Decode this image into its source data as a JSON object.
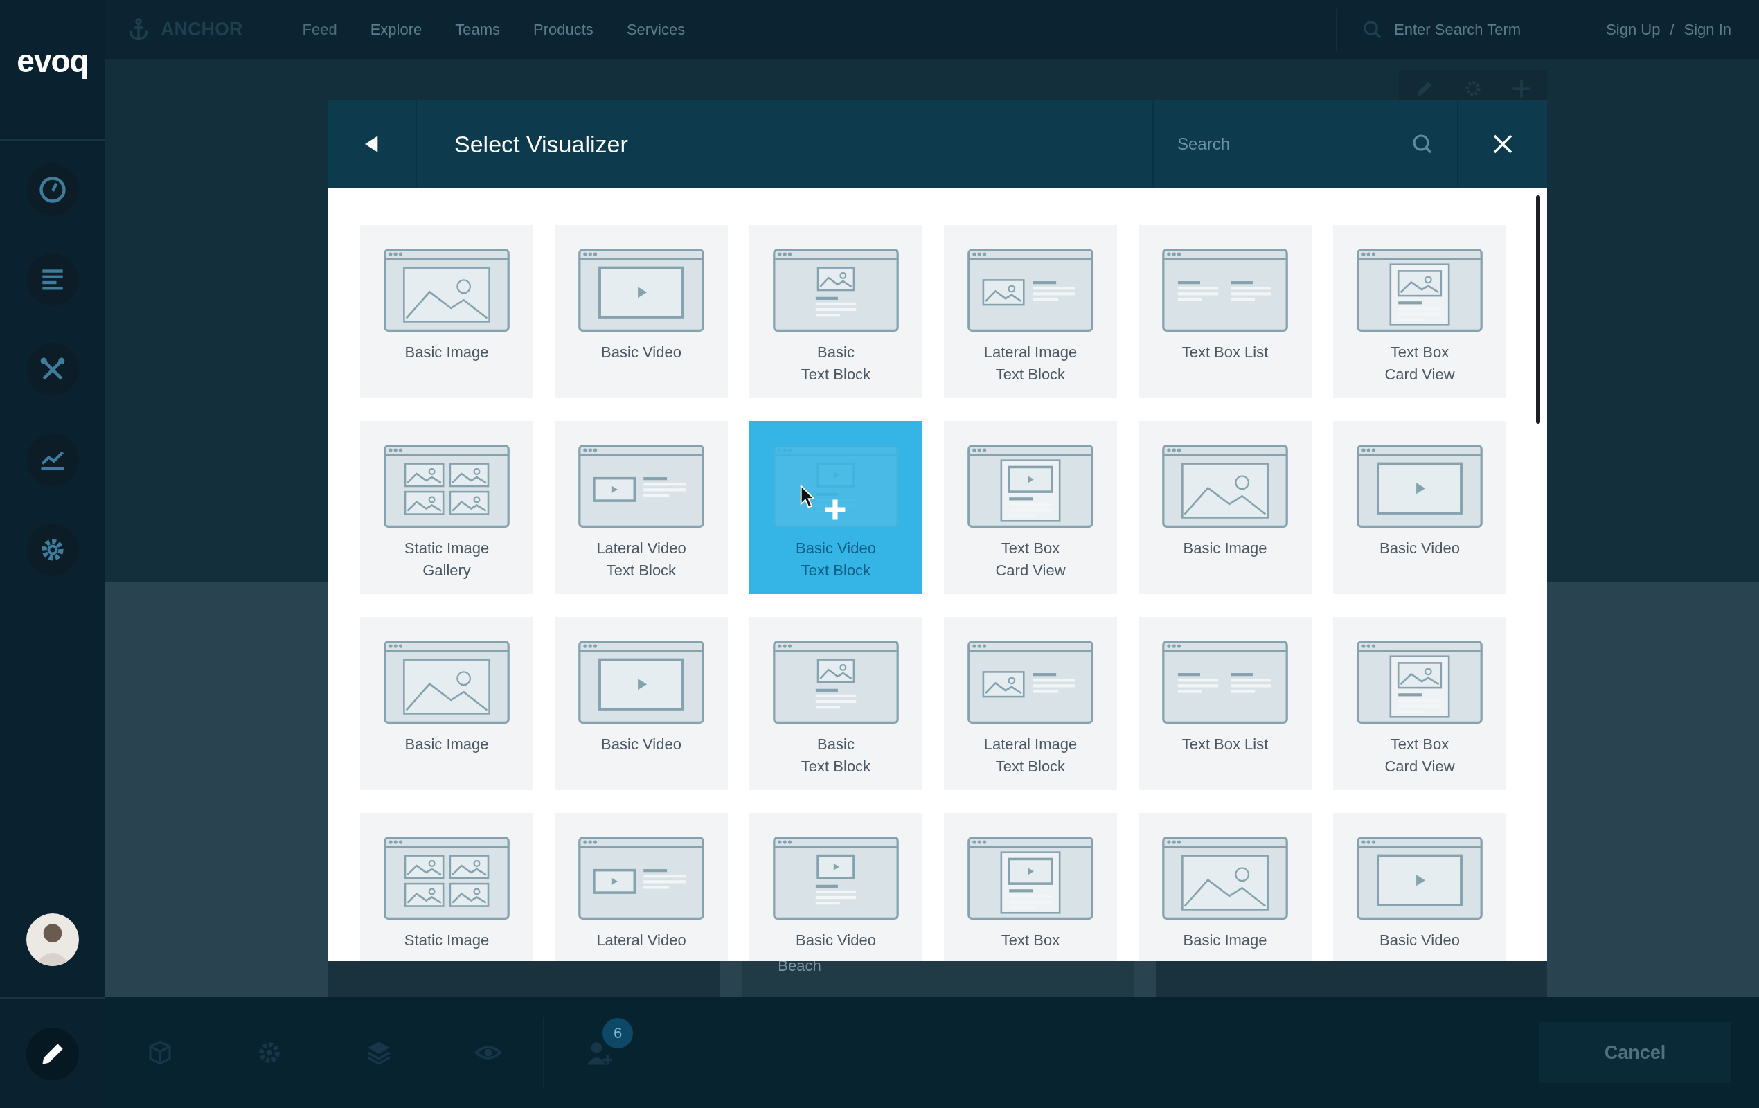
{
  "top_nav": {
    "brand": "ANCHOR",
    "links": [
      "Feed",
      "Explore",
      "Teams",
      "Products",
      "Services"
    ],
    "search_placeholder": "Enter Search Term",
    "sign_up": "Sign Up",
    "separator": "/",
    "sign_in": "Sign In"
  },
  "sidebar": {
    "logo": "evoq",
    "items": [
      {
        "kind": "dashboard"
      },
      {
        "kind": "content"
      },
      {
        "kind": "tools"
      },
      {
        "kind": "analytics"
      },
      {
        "kind": "settings"
      }
    ],
    "edit_button": {
      "kind": "pencil"
    }
  },
  "page": {
    "caption": "Beach"
  },
  "modal": {
    "title": "Select Visualizer",
    "search_placeholder": "Search",
    "tiles": [
      {
        "kind": "basic-image",
        "label": [
          "Basic Image"
        ],
        "selected": false
      },
      {
        "kind": "basic-video",
        "label": [
          "Basic Video"
        ],
        "selected": false
      },
      {
        "kind": "image-text-block",
        "label": [
          "Basic",
          "Text Block"
        ],
        "selected": false
      },
      {
        "kind": "lateral-image",
        "label": [
          "Lateral Image",
          "Text Block"
        ],
        "selected": false
      },
      {
        "kind": "text-list",
        "label": [
          "Text Box List"
        ],
        "selected": false
      },
      {
        "kind": "card-image",
        "label": [
          "Text Box",
          "Card View"
        ],
        "selected": false
      },
      {
        "kind": "gallery",
        "label": [
          "Static Image",
          "Gallery"
        ],
        "selected": false
      },
      {
        "kind": "lateral-video",
        "label": [
          "Lateral Video",
          "Text Block"
        ],
        "selected": false
      },
      {
        "kind": "video-text-block",
        "label": [
          "Basic Video",
          "Text Block"
        ],
        "selected": true
      },
      {
        "kind": "card-video",
        "label": [
          "Text Box",
          "Card View"
        ],
        "selected": false
      },
      {
        "kind": "basic-image",
        "label": [
          "Basic Image"
        ],
        "selected": false
      },
      {
        "kind": "basic-video",
        "label": [
          "Basic Video"
        ],
        "selected": false
      },
      {
        "kind": "basic-image",
        "label": [
          "Basic Image"
        ],
        "selected": false
      },
      {
        "kind": "basic-video",
        "label": [
          "Basic Video"
        ],
        "selected": false
      },
      {
        "kind": "image-text-block",
        "label": [
          "Basic",
          "Text Block"
        ],
        "selected": false
      },
      {
        "kind": "lateral-image",
        "label": [
          "Lateral Image",
          "Text Block"
        ],
        "selected": false
      },
      {
        "kind": "text-list",
        "label": [
          "Text Box List"
        ],
        "selected": false
      },
      {
        "kind": "card-image",
        "label": [
          "Text Box",
          "Card View"
        ],
        "selected": false
      },
      {
        "kind": "gallery",
        "label": [
          "Static Image"
        ],
        "selected": false
      },
      {
        "kind": "lateral-video",
        "label": [
          "Lateral Video"
        ],
        "selected": false
      },
      {
        "kind": "video-text-block",
        "label": [
          "Basic Video"
        ],
        "selected": false
      },
      {
        "kind": "card-video",
        "label": [
          "Text Box"
        ],
        "selected": false
      },
      {
        "kind": "basic-image",
        "label": [
          "Basic Image"
        ],
        "selected": false
      },
      {
        "kind": "basic-video",
        "label": [
          "Basic Video"
        ],
        "selected": false
      }
    ]
  },
  "bottom_bar": {
    "tools": [
      {
        "kind": "cube"
      },
      {
        "kind": "gear"
      },
      {
        "kind": "layers"
      },
      {
        "kind": "eye"
      },
      {
        "kind": "user-add",
        "badge": "6"
      }
    ],
    "cancel": "Cancel"
  }
}
